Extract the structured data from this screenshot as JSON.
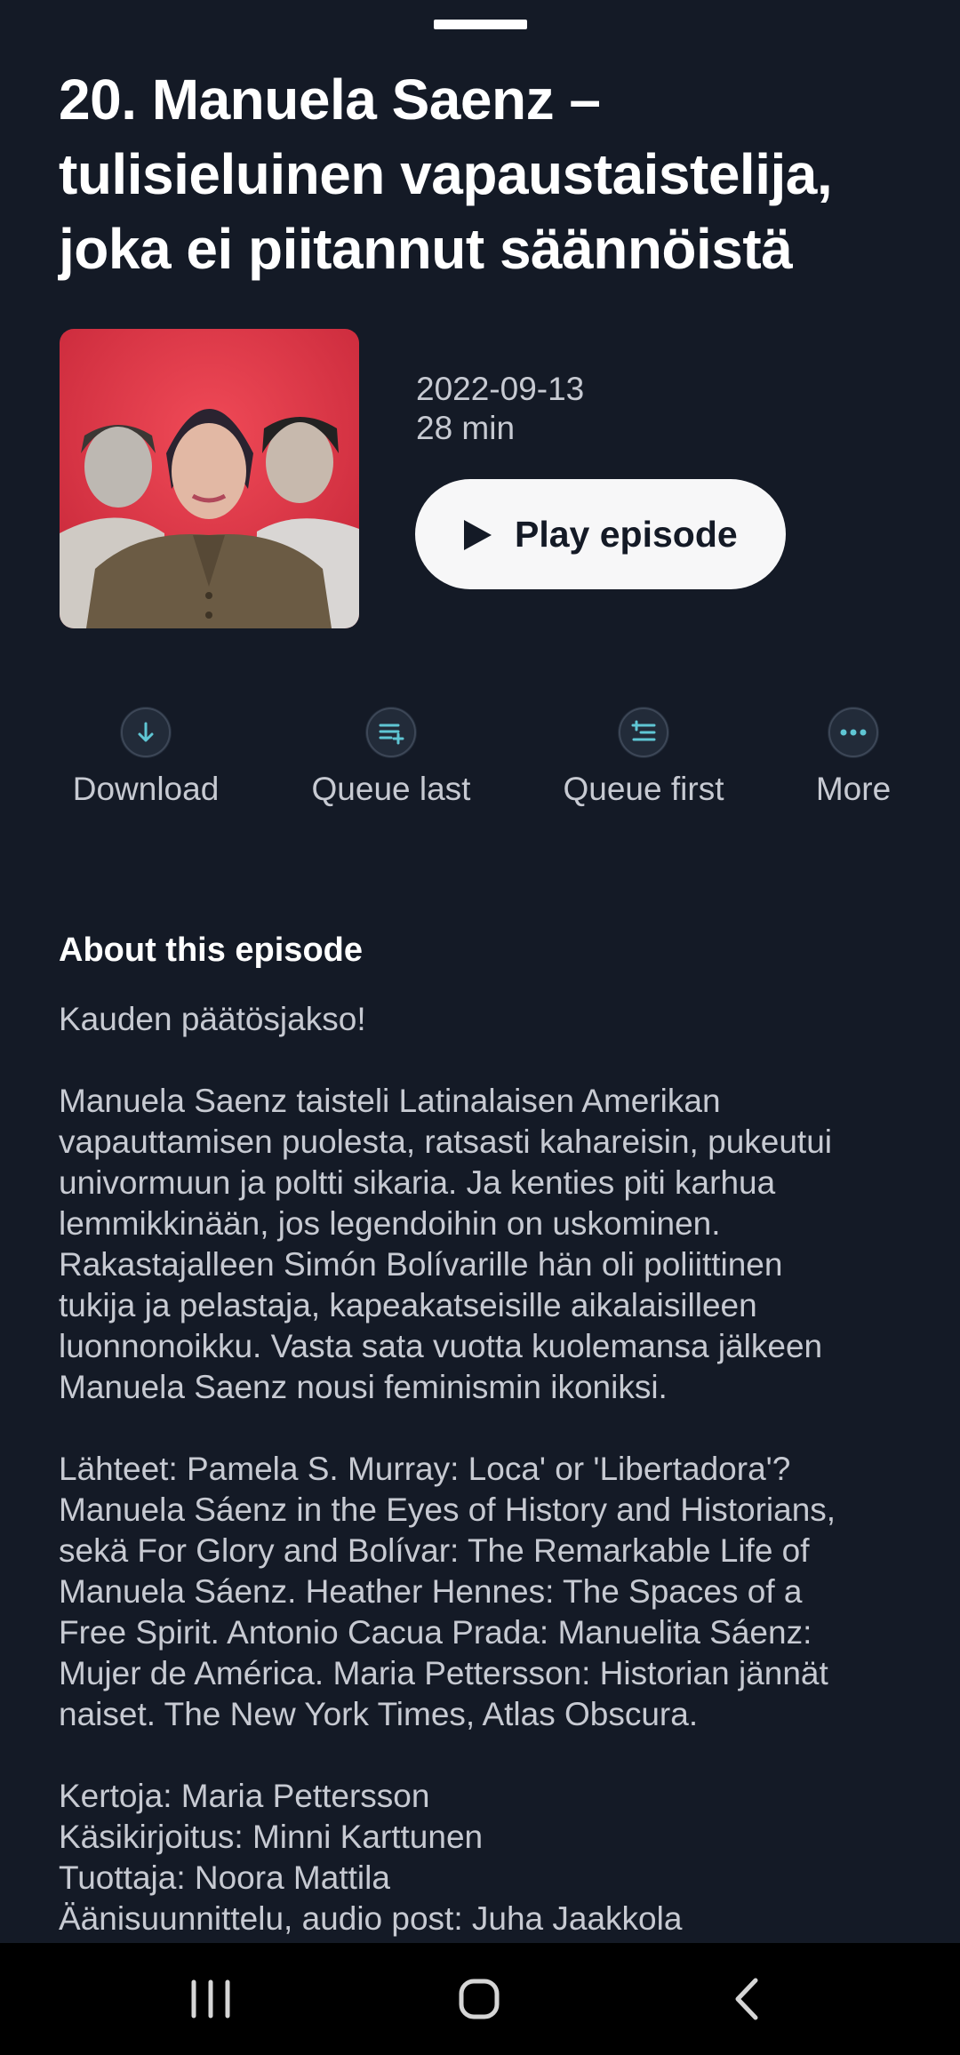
{
  "episode": {
    "title_lines": [
      "20. Manuela Saenz –",
      "tulisieluinen vapaustaistelija,",
      "joka ei piitannut säännöistä"
    ],
    "date": "2022-09-13",
    "duration": "28 min",
    "play_label": "Play episode"
  },
  "actions": [
    {
      "label": "Download",
      "icon": "download-icon"
    },
    {
      "label": "Queue last",
      "icon": "queue-last-icon"
    },
    {
      "label": "Queue first",
      "icon": "queue-first-icon"
    },
    {
      "label": "More",
      "icon": "more-icon"
    }
  ],
  "about": {
    "heading": "About this episode",
    "paragraphs": [
      [
        "Kauden päätösjakso!"
      ],
      [
        "Manuela Saenz taisteli Latinalaisen Amerikan",
        "vapauttamisen puolesta, ratsasti kahareisin, pukeutui",
        "univormuun ja poltti sikaria. Ja kenties piti karhua",
        "lemmikkinään, jos legendoihin on uskominen.",
        "Rakastajalleen Simón Bolívarille hän oli poliittinen",
        "tukija ja pelastaja, kapeakatseisille aikalaisilleen",
        "luonnonoikku. Vasta sata vuotta kuolemansa jälkeen",
        "Manuela Saenz nousi feminismin ikoniksi."
      ],
      [
        "Lähteet: Pamela S. Murray: Loca' or 'Libertadora'?",
        "Manuela Sáenz in the Eyes of History and Historians,",
        "sekä For Glory and Bolívar: The Remarkable Life of",
        "Manuela Sáenz. Heather Hennes: The Spaces of a",
        "Free Spirit. Antonio Cacua Prada: Manuelita Sáenz:",
        "Mujer de América. Maria Pettersson: Historian jännät",
        "naiset. The New York Times, Atlas Obscura."
      ],
      [
        "Kertoja: Maria Pettersson",
        "Käsikirjoitus: Minni Karttunen",
        "Tuottaja: Noora Mattila",
        "Äänisuunnittelu, audio post: Juha Jaakkola"
      ]
    ]
  },
  "nav": {
    "buttons": [
      "recent-apps-icon",
      "home-icon",
      "back-icon"
    ]
  },
  "colors": {
    "background": "#141a26",
    "accent": "#5fc6d4",
    "icon_circle": "#222b39",
    "secondary_text": "#c7cad2",
    "cover_red": "#e23a48"
  }
}
